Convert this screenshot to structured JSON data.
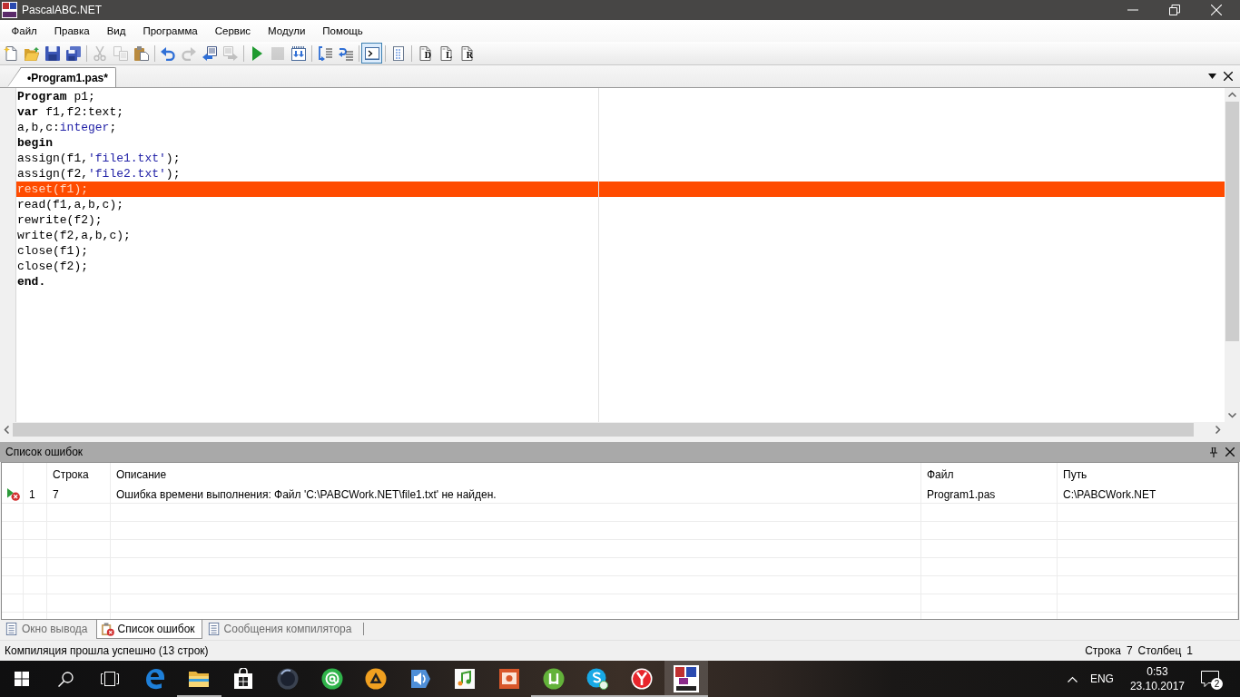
{
  "window": {
    "title": "PascalABC.NET"
  },
  "menu": [
    "Файл",
    "Правка",
    "Вид",
    "Программа",
    "Сервис",
    "Модули",
    "Помощь"
  ],
  "toolbar": [
    {
      "kind": "new",
      "disabled": false,
      "pressed": false
    },
    {
      "kind": "open",
      "disabled": false,
      "pressed": false
    },
    {
      "kind": "save",
      "disabled": false,
      "pressed": false
    },
    {
      "kind": "saveall",
      "disabled": false,
      "pressed": false
    },
    {
      "kind": "separator"
    },
    {
      "kind": "cut",
      "disabled": true,
      "pressed": false
    },
    {
      "kind": "copy",
      "disabled": true,
      "pressed": false
    },
    {
      "kind": "paste",
      "disabled": false,
      "pressed": false
    },
    {
      "kind": "separator"
    },
    {
      "kind": "undo",
      "disabled": false,
      "pressed": false
    },
    {
      "kind": "redo",
      "disabled": true,
      "pressed": false
    },
    {
      "kind": "back",
      "disabled": false,
      "pressed": false
    },
    {
      "kind": "forward",
      "disabled": true,
      "pressed": false
    },
    {
      "kind": "separator"
    },
    {
      "kind": "run",
      "disabled": false,
      "pressed": false
    },
    {
      "kind": "stop",
      "disabled": true,
      "pressed": false
    },
    {
      "kind": "compile",
      "disabled": false,
      "pressed": false
    },
    {
      "kind": "separator"
    },
    {
      "kind": "stepinto",
      "disabled": false,
      "pressed": false
    },
    {
      "kind": "stepover",
      "disabled": false,
      "pressed": false
    },
    {
      "kind": "separator"
    },
    {
      "kind": "console",
      "disabled": false,
      "pressed": true
    },
    {
      "kind": "separator"
    },
    {
      "kind": "outline",
      "disabled": false,
      "pressed": false
    },
    {
      "kind": "separator"
    },
    {
      "kind": "letter",
      "label": "D",
      "disabled": false,
      "pressed": false
    },
    {
      "kind": "letter",
      "label": "L",
      "disabled": false,
      "pressed": false
    },
    {
      "kind": "letter",
      "label": "R",
      "disabled": false,
      "pressed": false
    }
  ],
  "document_tabs": [
    {
      "label": "•Program1.pas*",
      "selected": true
    }
  ],
  "editor": {
    "lines": [
      {
        "error": false,
        "tokens": [
          {
            "kind": "keyword",
            "text": "Program"
          },
          {
            "kind": "plain",
            "text": " p1;"
          }
        ]
      },
      {
        "error": false,
        "tokens": [
          {
            "kind": "keyword",
            "text": "var"
          },
          {
            "kind": "plain",
            "text": " f1,f2:text;"
          }
        ]
      },
      {
        "error": false,
        "tokens": [
          {
            "kind": "plain",
            "text": "a,b,c:"
          },
          {
            "kind": "type",
            "text": "integer"
          },
          {
            "kind": "plain",
            "text": ";"
          }
        ]
      },
      {
        "error": false,
        "tokens": [
          {
            "kind": "keyword",
            "text": "begin"
          }
        ]
      },
      {
        "error": false,
        "tokens": [
          {
            "kind": "plain",
            "text": "assign(f1,"
          },
          {
            "kind": "string",
            "text": "'file1.txt'"
          },
          {
            "kind": "plain",
            "text": ");"
          }
        ]
      },
      {
        "error": false,
        "tokens": [
          {
            "kind": "plain",
            "text": "assign(f2,"
          },
          {
            "kind": "string",
            "text": "'file2.txt'"
          },
          {
            "kind": "plain",
            "text": ");"
          }
        ]
      },
      {
        "error": true,
        "tokens": [
          {
            "kind": "plain",
            "text": "reset(f1);"
          }
        ]
      },
      {
        "error": false,
        "tokens": [
          {
            "kind": "plain",
            "text": "read(f1,a,b,c);"
          }
        ]
      },
      {
        "error": false,
        "tokens": [
          {
            "kind": "plain",
            "text": "rewrite(f2);"
          }
        ]
      },
      {
        "error": false,
        "tokens": [
          {
            "kind": "plain",
            "text": "write(f2,a,b,c);"
          }
        ]
      },
      {
        "error": false,
        "tokens": [
          {
            "kind": "plain",
            "text": "close(f1);"
          }
        ]
      },
      {
        "error": false,
        "tokens": [
          {
            "kind": "plain",
            "text": "close(f2);"
          }
        ]
      },
      {
        "error": false,
        "tokens": [
          {
            "kind": "keyword",
            "text": "end."
          }
        ]
      }
    ]
  },
  "error_list": {
    "title": "Список ошибок",
    "columns": [
      "Строка",
      "Описание",
      "Файл",
      "Путь"
    ],
    "rows": [
      {
        "kind": "error",
        "number": "1",
        "line": "7",
        "description": "Ошибка времени выполнения: Файл 'C:\\PABCWork.NET\\file1.txt' не найден.",
        "file": "Program1.pas",
        "path": "C:\\PABCWork.NET"
      }
    ]
  },
  "bottom_tabs": [
    {
      "kind": "output",
      "label": "Окно вывода",
      "selected": false
    },
    {
      "kind": "errors",
      "label": "Список ошибок",
      "selected": true
    },
    {
      "kind": "messages",
      "label": "Сообщения компилятора",
      "selected": false
    }
  ],
  "status_bar": {
    "message": "Компиляция прошла успешно (13 строк)",
    "line_label": "Строка",
    "line": "7",
    "column_label": "Столбец",
    "column": "1"
  },
  "taskbar": {
    "apps": [
      {
        "kind": "edge",
        "running": false,
        "active": false
      },
      {
        "kind": "explorer",
        "running": true,
        "active": false
      },
      {
        "kind": "store",
        "running": false,
        "active": false
      },
      {
        "kind": "sphere",
        "running": false,
        "active": false
      },
      {
        "kind": "mail",
        "running": false,
        "active": false
      },
      {
        "kind": "player",
        "running": false,
        "active": false
      },
      {
        "kind": "speaker",
        "running": false,
        "active": false
      },
      {
        "kind": "music",
        "running": false,
        "active": false
      },
      {
        "kind": "slides",
        "running": false,
        "active": false
      },
      {
        "kind": "torrent",
        "running": true,
        "active": false
      },
      {
        "kind": "skype",
        "running": true,
        "active": false
      },
      {
        "kind": "yandex",
        "running": true,
        "active": false
      },
      {
        "kind": "pascal",
        "running": true,
        "active": true
      }
    ],
    "language": "ENG",
    "time": "0:53",
    "date": "23.10.2017",
    "notifications": "2"
  }
}
